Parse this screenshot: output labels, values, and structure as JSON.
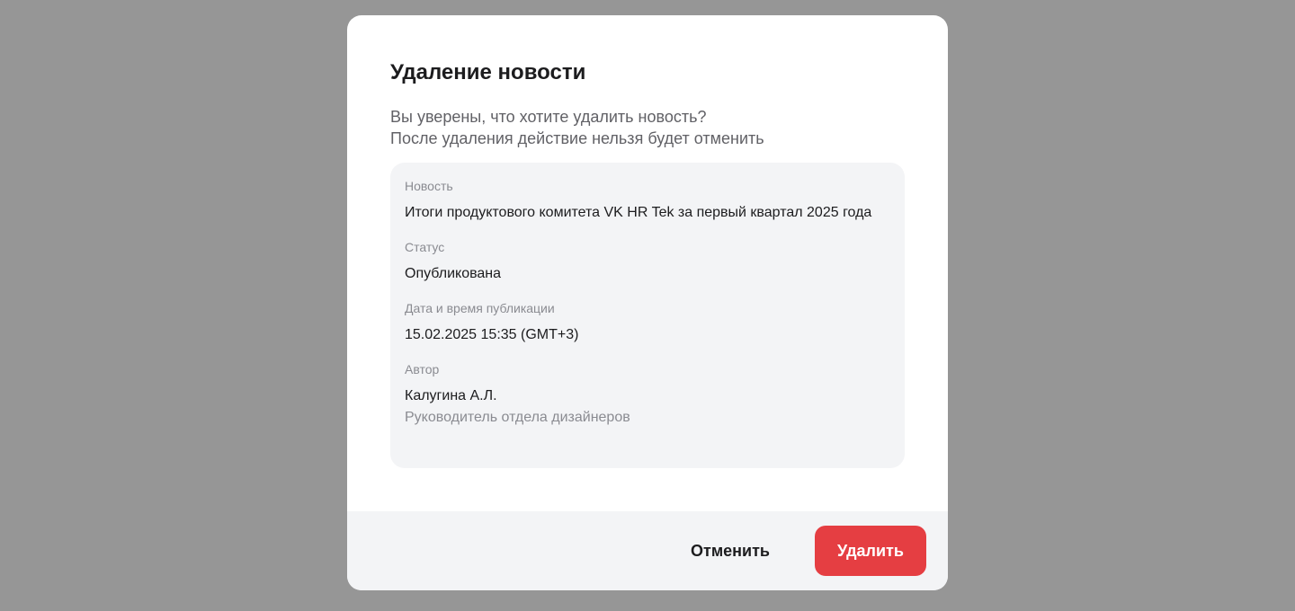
{
  "dialog": {
    "title": "Удаление новости",
    "description_line1": "Вы уверены, что хотите удалить новость?",
    "description_line2": "После удаления действие нельзя будет отменить"
  },
  "details": {
    "news_label": "Новость",
    "news_value": "Итоги продуктового комитета VK HR Tek за первый квартал 2025 года",
    "status_label": "Статус",
    "status_value": "Опубликована",
    "date_label": "Дата и время публикации",
    "date_value": "15.02.2025 15:35 (GMT+3)",
    "author_label": "Автор",
    "author_name": "Калугина А.Л.",
    "author_position": "Руководитель отдела дизайнеров"
  },
  "actions": {
    "cancel_label": "Отменить",
    "delete_label": "Удалить"
  },
  "colors": {
    "overlay": "#969696",
    "card_background": "#f3f4f6",
    "danger": "#e53e42",
    "text_primary": "#1c1c1e",
    "text_secondary": "#8a8b91"
  }
}
